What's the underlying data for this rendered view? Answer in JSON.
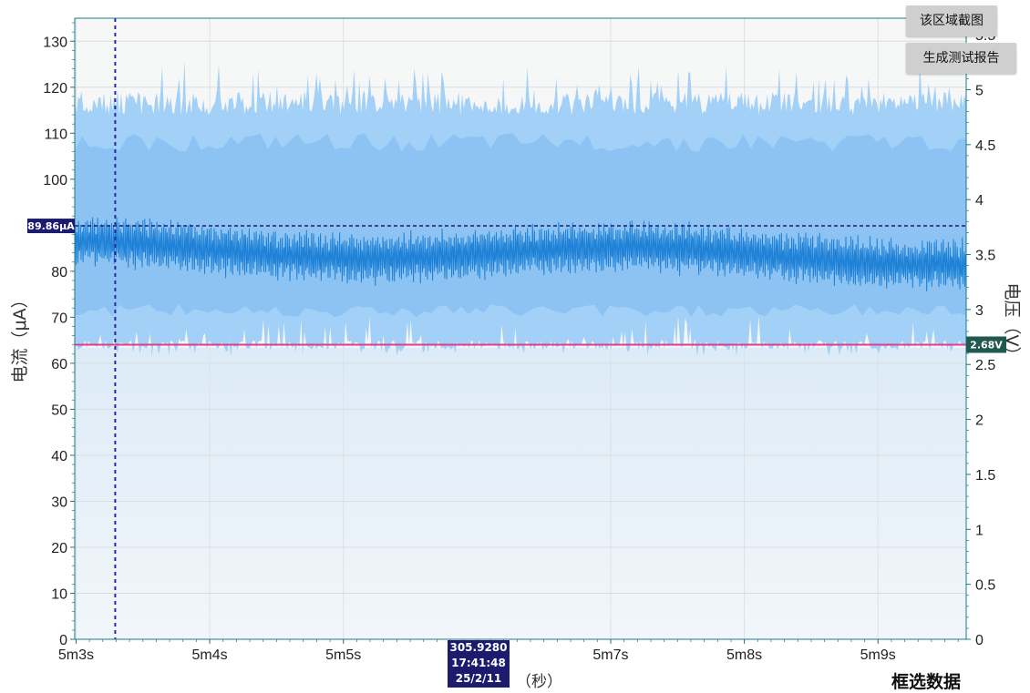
{
  "colors": {
    "plot_bg_top": "#f6f6f6",
    "plot_bg_bottom": "#eef5fb",
    "envelope_fill": "#9fcdf5",
    "mid_fill": "#86c0f4",
    "current_line": "#1f82d6",
    "voltage_line": "#e43b8c",
    "avg_current_marker": "#1d1b6e",
    "voltage_marker": "#21584f",
    "cursor_line": "#2b2a9a",
    "axis": "#1a7a8a"
  },
  "toolbar": {
    "screenshot_label": "该区域截图",
    "report_label": "生成测试报告",
    "select_data_label": "框选数据"
  },
  "cursor": {
    "value": "305.9280",
    "time": "17:41:48",
    "date": "25/2/11"
  },
  "x_unit_label": "（秒）",
  "chart_data": {
    "type": "area",
    "x_range_seconds": [
      302.9,
      369.6
    ],
    "x_tick_labels": [
      "5m3s",
      "5m4s",
      "5m5s",
      "5m7s",
      "5m8s",
      "5m9s"
    ],
    "x_tick_seconds": [
      303,
      313,
      323,
      343,
      353,
      363
    ],
    "left_axis": {
      "label": "电流（μA）",
      "range": [
        0,
        135
      ],
      "ticks": [
        0,
        10,
        20,
        30,
        40,
        50,
        60,
        70,
        80,
        90,
        100,
        110,
        120,
        130
      ]
    },
    "right_axis": {
      "label": "电压（V）",
      "range": [
        0,
        5.65
      ],
      "ticks": [
        "0",
        "0.5",
        "1",
        "1.5",
        "2",
        "2.5",
        "3",
        "3.5",
        "4",
        "4.5",
        "5",
        "5.5"
      ]
    },
    "series": [
      {
        "axis": "left",
        "envelope_max_approx": 118,
        "envelope_min_approx": 63,
        "center_approx": 85
      },
      {
        "axis": "right",
        "value": 2.68
      }
    ],
    "markers": {
      "average_current": "89.86μA",
      "average_current_value": 89.86,
      "voltage": "2.68V",
      "voltage_value": 2.68,
      "cursor_x_seconds": 305.928
    }
  }
}
